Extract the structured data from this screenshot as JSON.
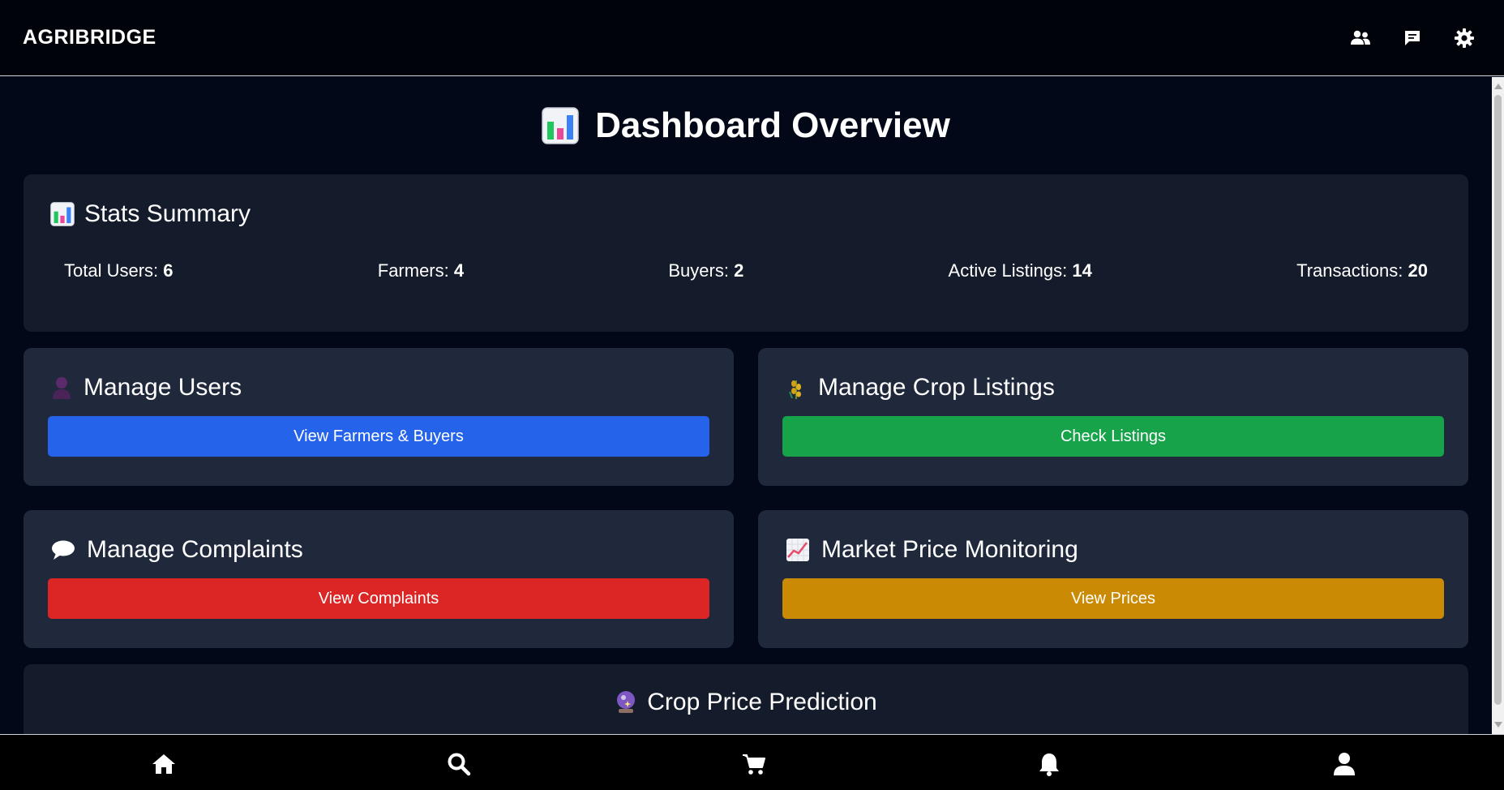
{
  "app": {
    "brand": "AGRIBRIDGE"
  },
  "topbar": {
    "icons": [
      "users-icon",
      "chat-icon",
      "gear-icon"
    ]
  },
  "page": {
    "title": "Dashboard Overview",
    "title_icon": "bar-chart-icon"
  },
  "stats": {
    "heading": "Stats Summary",
    "items": [
      {
        "label": "Total Users:",
        "value": "6"
      },
      {
        "label": "Farmers:",
        "value": "4"
      },
      {
        "label": "Buyers:",
        "value": "2"
      },
      {
        "label": "Active Listings:",
        "value": "14"
      },
      {
        "label": "Transactions:",
        "value": "20"
      }
    ]
  },
  "panels": {
    "users": {
      "heading": "Manage Users",
      "icon": "person-icon",
      "button": "View Farmers & Buyers",
      "color": "#2563eb"
    },
    "listings": {
      "heading": "Manage Crop Listings",
      "icon": "crop-icon",
      "button": "Check Listings",
      "color": "#16a34a"
    },
    "complaints": {
      "heading": "Manage Complaints",
      "icon": "speech-bubble-icon",
      "button": "View Complaints",
      "color": "#dc2626"
    },
    "prices": {
      "heading": "Market Price Monitoring",
      "icon": "trend-chart-icon",
      "button": "View Prices",
      "color": "#ca8a04"
    }
  },
  "prediction": {
    "heading": "Crop Price Prediction",
    "icon": "crystal-ball-icon"
  },
  "bottomnav": {
    "items": [
      "home-icon",
      "search-icon",
      "cart-icon",
      "bell-icon",
      "user-icon"
    ]
  }
}
